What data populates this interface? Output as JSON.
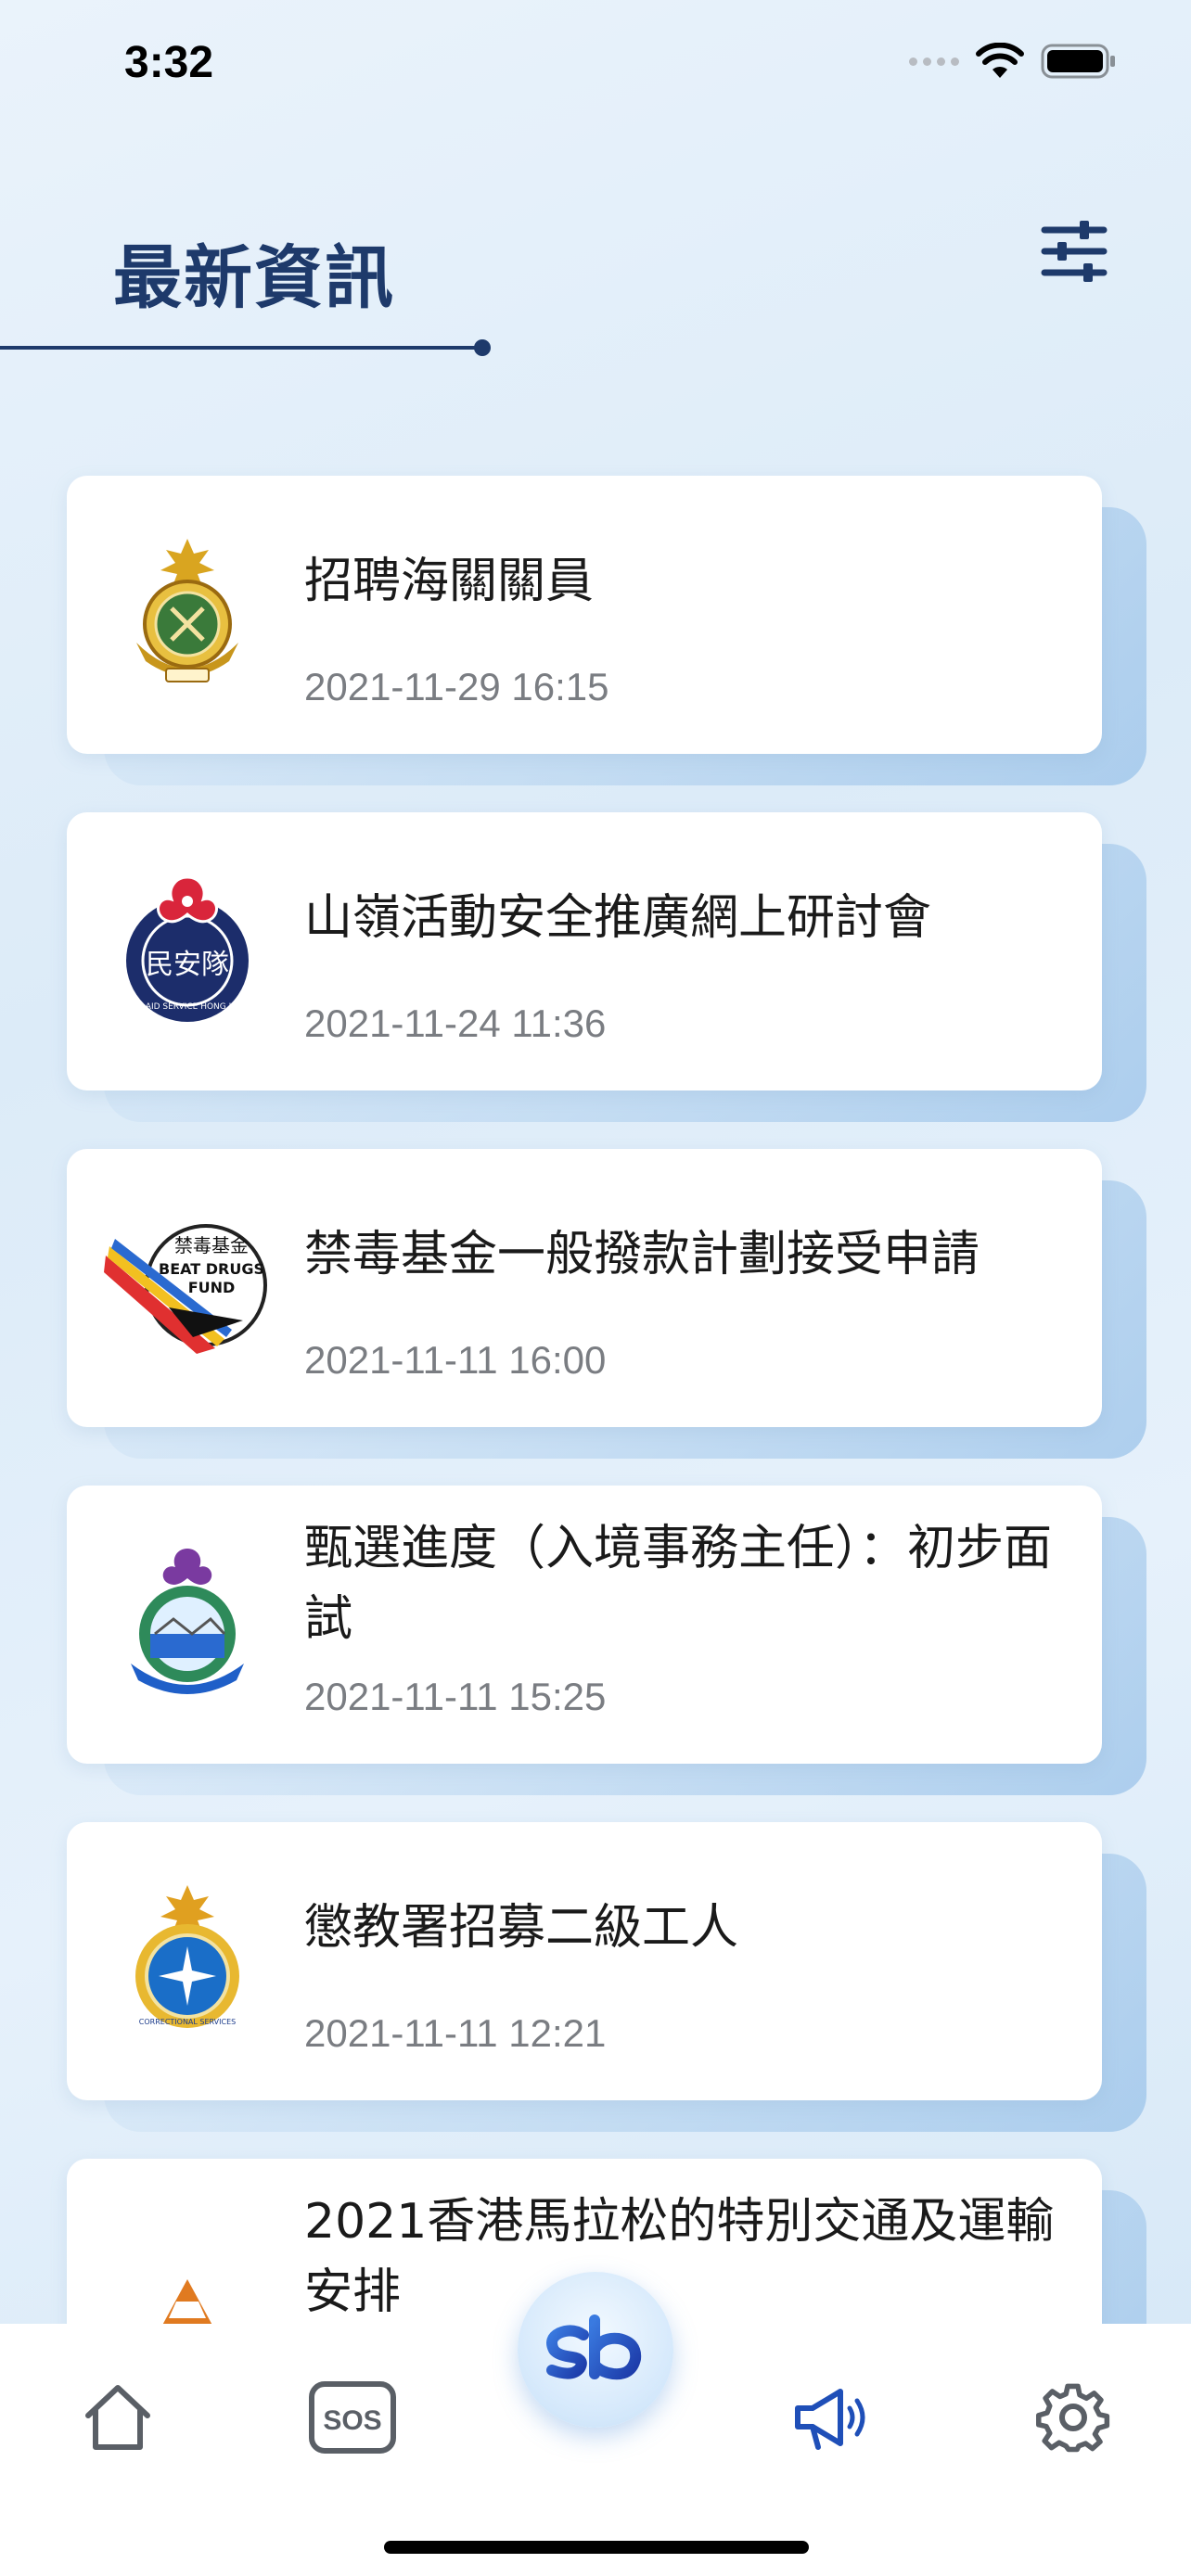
{
  "status_bar": {
    "time": "3:32"
  },
  "header": {
    "title": "最新資訊"
  },
  "news": [
    {
      "title": "招聘海關關員",
      "date": "2021-11-29 16:15",
      "logo": "customs-crest-icon"
    },
    {
      "title": "山嶺活動安全推廣網上研討會",
      "date": "2021-11-24 11:36",
      "logo": "civil-aid-service-crest-icon"
    },
    {
      "title": "禁毒基金一般撥款計劃接受申請",
      "date": "2021-11-11 16:00",
      "logo": "beat-drugs-fund-logo-icon"
    },
    {
      "title": "甄選進度（入境事務主任）：初步面試",
      "date": "2021-11-11 15:25",
      "logo": "immigration-crest-icon"
    },
    {
      "title": "懲教署招募二級工人",
      "date": "2021-11-11 12:21",
      "logo": "correctional-services-crest-icon"
    },
    {
      "title": "2021香港馬拉松的特別交通及運輸安排",
      "date": "",
      "logo": "traffic-cone-icon"
    }
  ],
  "logos": {
    "civil_aid_text": "民安隊",
    "civil_aid_ring": "CIVIL AID SERVICE HONG KONG",
    "bdf_cn": "禁毒基金",
    "bdf_en1": "BEAT DRUGS",
    "bdf_en2": "FUND",
    "csd_ring": "CORRECTIONAL SERVICES",
    "center_logo": "sb"
  },
  "tabs": {
    "sos_label": "SOS",
    "active_tab": "announcements",
    "active_color": "#1f4fb8",
    "inactive_color": "#5a5f66"
  },
  "colors": {
    "title": "#1e3a6b",
    "date": "#7a7d82"
  }
}
